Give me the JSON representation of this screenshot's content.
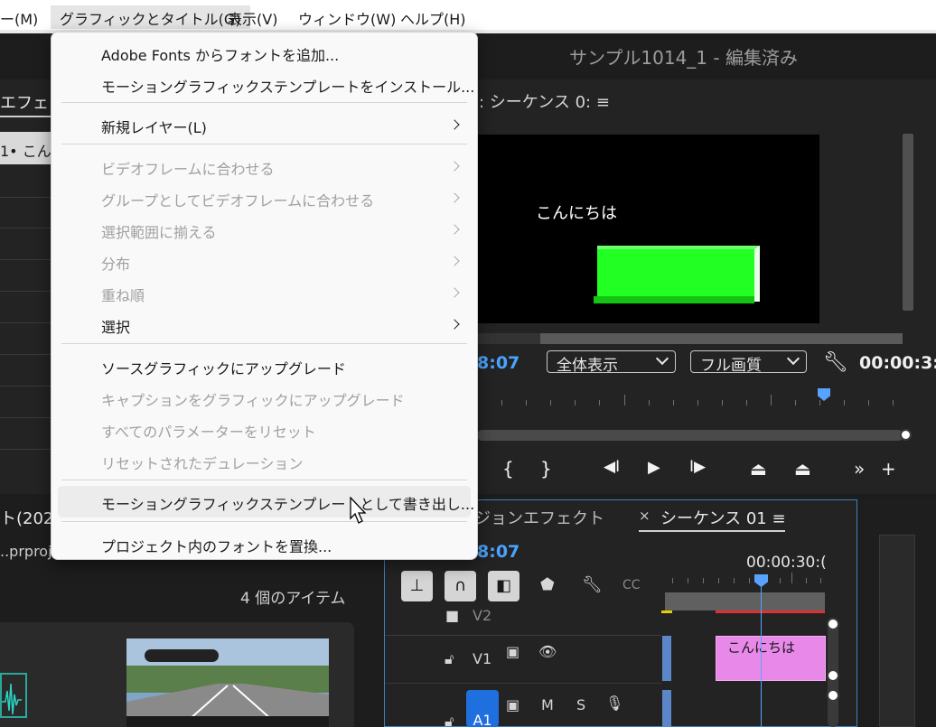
{
  "menubar": {
    "items": [
      "ー(M)",
      "グラフィックとタイトル(G)",
      "表示(V)",
      "ウィンドウ(W)",
      "ヘルプ(H)"
    ]
  },
  "app": {
    "title": "サンプル1014_1 - 編集済み"
  },
  "left_panel": {
    "tab": "エフェク",
    "row": "1• こん"
  },
  "program_monitor": {
    "tab": ": シーケンス 0: ≡",
    "overlay_text": "こんにちは",
    "timecode_left": "8:07",
    "zoom": "全体表示",
    "quality": "フル画質",
    "timecode_right": "00:00:3:"
  },
  "transport": {
    "mark_in": "{",
    "mark_out": "}",
    "step_back": "◀I",
    "play": "▶",
    "step_forward": "I▶",
    "more": "»",
    "add": "+"
  },
  "project": {
    "tab": "ト(202",
    "file": "..prproj",
    "count": "4 個のアイテム"
  },
  "timeline": {
    "tab_effects": "ジョンエフェクト",
    "tab_close": "×",
    "tab_sequence": "シーケンス 01 ≡",
    "timecode": "8:07",
    "ruler_time": "00:00:30:(",
    "tracks": [
      "V2",
      "V1",
      "A1"
    ],
    "track_m": "M",
    "track_s": "S",
    "clip_text": "こんにちは",
    "cc": "CC"
  },
  "menu": {
    "items": [
      {
        "label": "Adobe Fonts からフォントを追加...",
        "enabled": true,
        "submenu": false
      },
      {
        "label": "モーショングラフィックステンプレートをインストール...",
        "enabled": true,
        "submenu": false
      },
      {
        "label": "新規レイヤー(L)",
        "enabled": true,
        "submenu": true
      },
      {
        "label": "ビデオフレームに合わせる",
        "enabled": false,
        "submenu": true
      },
      {
        "label": "グループとしてビデオフレームに合わせる",
        "enabled": false,
        "submenu": true
      },
      {
        "label": "選択範囲に揃える",
        "enabled": false,
        "submenu": true
      },
      {
        "label": "分布",
        "enabled": false,
        "submenu": true
      },
      {
        "label": "重ね順",
        "enabled": false,
        "submenu": true
      },
      {
        "label": "選択",
        "enabled": true,
        "submenu": true
      },
      {
        "label": "ソースグラフィックにアップグレード",
        "enabled": true,
        "submenu": false
      },
      {
        "label": "キャプションをグラフィックにアップグレード",
        "enabled": false,
        "submenu": false
      },
      {
        "label": "すべてのパラメーターをリセット",
        "enabled": false,
        "submenu": false
      },
      {
        "label": "リセットされたデュレーション",
        "enabled": false,
        "submenu": false
      },
      {
        "label": "モーショングラフィックステンプレートとして書き出し...",
        "enabled": true,
        "submenu": false,
        "hovered": true
      },
      {
        "label": "プロジェクト内のフォントを置換...",
        "enabled": true,
        "submenu": false
      }
    ]
  },
  "colors": {
    "accent_blue": "#4aa3ff",
    "clip_pink": "#e888e8",
    "overlay_green": "#22ff22",
    "audio_track_blue": "#1f6fde"
  }
}
